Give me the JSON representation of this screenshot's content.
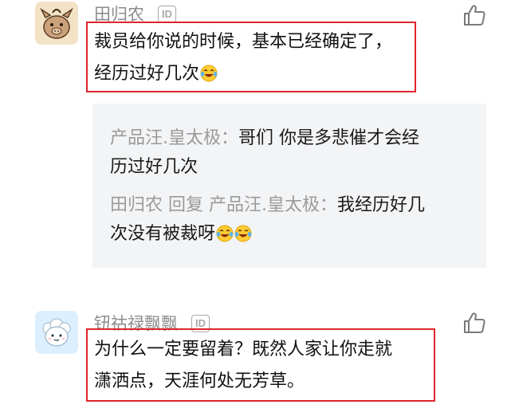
{
  "comments": [
    {
      "username": "田归农",
      "id_badge": "ID",
      "avatar": "cartoon-animal-avatar",
      "body_line1": "裁员给你说的时候，基本已经确定了，",
      "body_line2": "经历过好几次",
      "body_emoji": "laugh-cry-emoji",
      "replies": [
        {
          "author": "产品汪.皇太极",
          "separator": "：",
          "line1": "哥们 你是多悲催才会经",
          "line2": "历过好几次"
        },
        {
          "author": "田归农",
          "reply_word": "回复",
          "target": "产品汪.皇太极",
          "separator": "：",
          "line1": "我经历好几",
          "line2": "次没有被裁呀",
          "emojis": [
            "laugh-cry-emoji",
            "laugh-cry-emoji"
          ]
        }
      ]
    },
    {
      "username": "钮祜禄飘飘",
      "id_badge": "ID",
      "avatar": "cartoon-sheep-avatar",
      "body_line1": "为什么一定要留着？既然人家让你走就",
      "body_line2": "潇洒点，天涯何处无芳草。"
    }
  ],
  "colors": {
    "highlight_border": "#e0242c",
    "reply_panel_bg": "#f3f4f6",
    "muted_text": "#9a9a9a"
  },
  "icons": {
    "like": "thumbs-up-icon"
  }
}
